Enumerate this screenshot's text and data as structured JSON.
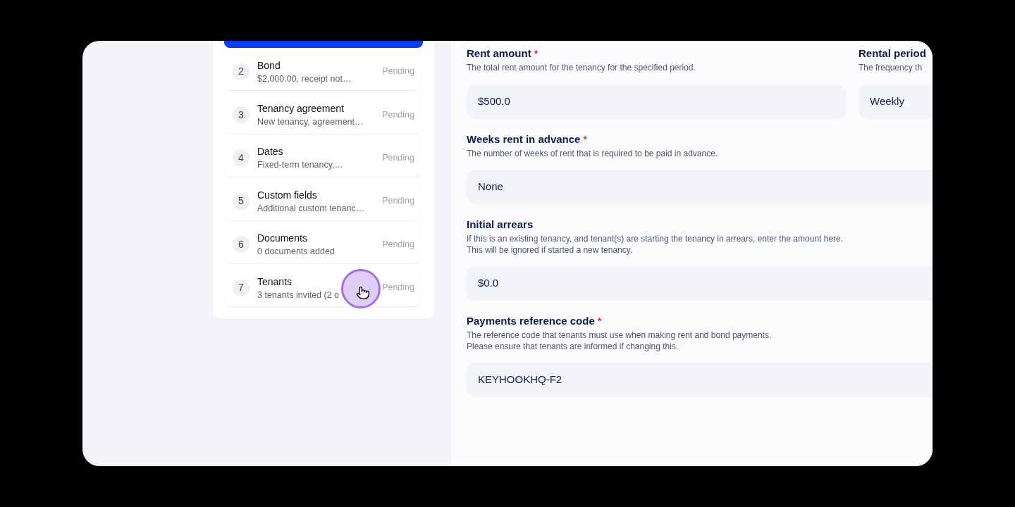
{
  "steps_panel": {
    "steps": [
      {
        "number": "2",
        "title": "Bond",
        "subtitle": "$2,000.00, receipt not…",
        "status": "Pending"
      },
      {
        "number": "3",
        "title": "Tenancy agreement",
        "subtitle": "New tenancy, agreement…",
        "status": "Pending"
      },
      {
        "number": "4",
        "title": "Dates",
        "subtitle": "Fixed-term tenancy,…",
        "status": "Pending"
      },
      {
        "number": "5",
        "title": "Custom fields",
        "subtitle": "Additional custom tenanc…",
        "status": "Pending"
      },
      {
        "number": "6",
        "title": "Documents",
        "subtitle": "0 documents added",
        "status": "Pending"
      },
      {
        "number": "7",
        "title": "Tenants",
        "subtitle": "3 tenants invited (2 o",
        "status": "Pending"
      }
    ]
  },
  "form": {
    "rows": [
      {
        "fields": [
          {
            "label": "Rent amount",
            "required_mark": "*",
            "description": [
              "The total rent amount for the tenancy for the specified period."
            ],
            "value": "$500.0"
          },
          {
            "label": "Rental period",
            "description": [
              "The frequency th"
            ],
            "value": "Weekly"
          }
        ]
      },
      {
        "fields": [
          {
            "label": "Weeks rent in advance",
            "required_mark": "*",
            "description": [
              "The number of weeks of rent that is required to be paid in advance."
            ],
            "value": "None"
          }
        ]
      },
      {
        "fields": [
          {
            "label": "Initial arrears",
            "description": [
              "If this is an existing tenancy, and tenant(s) are starting the tenancy in arrears, enter the amount here.",
              "This will be ignored if started a new tenancy."
            ],
            "value": "$0.0"
          }
        ]
      },
      {
        "fields": [
          {
            "label": "Payments reference code",
            "required_mark": "*",
            "description": [
              "The reference code that tenants must use when making rent and bond payments.",
              "Please ensure that tenants are informed if changing this."
            ],
            "value": "KEYHOOKHQ-F2"
          }
        ]
      }
    ]
  }
}
